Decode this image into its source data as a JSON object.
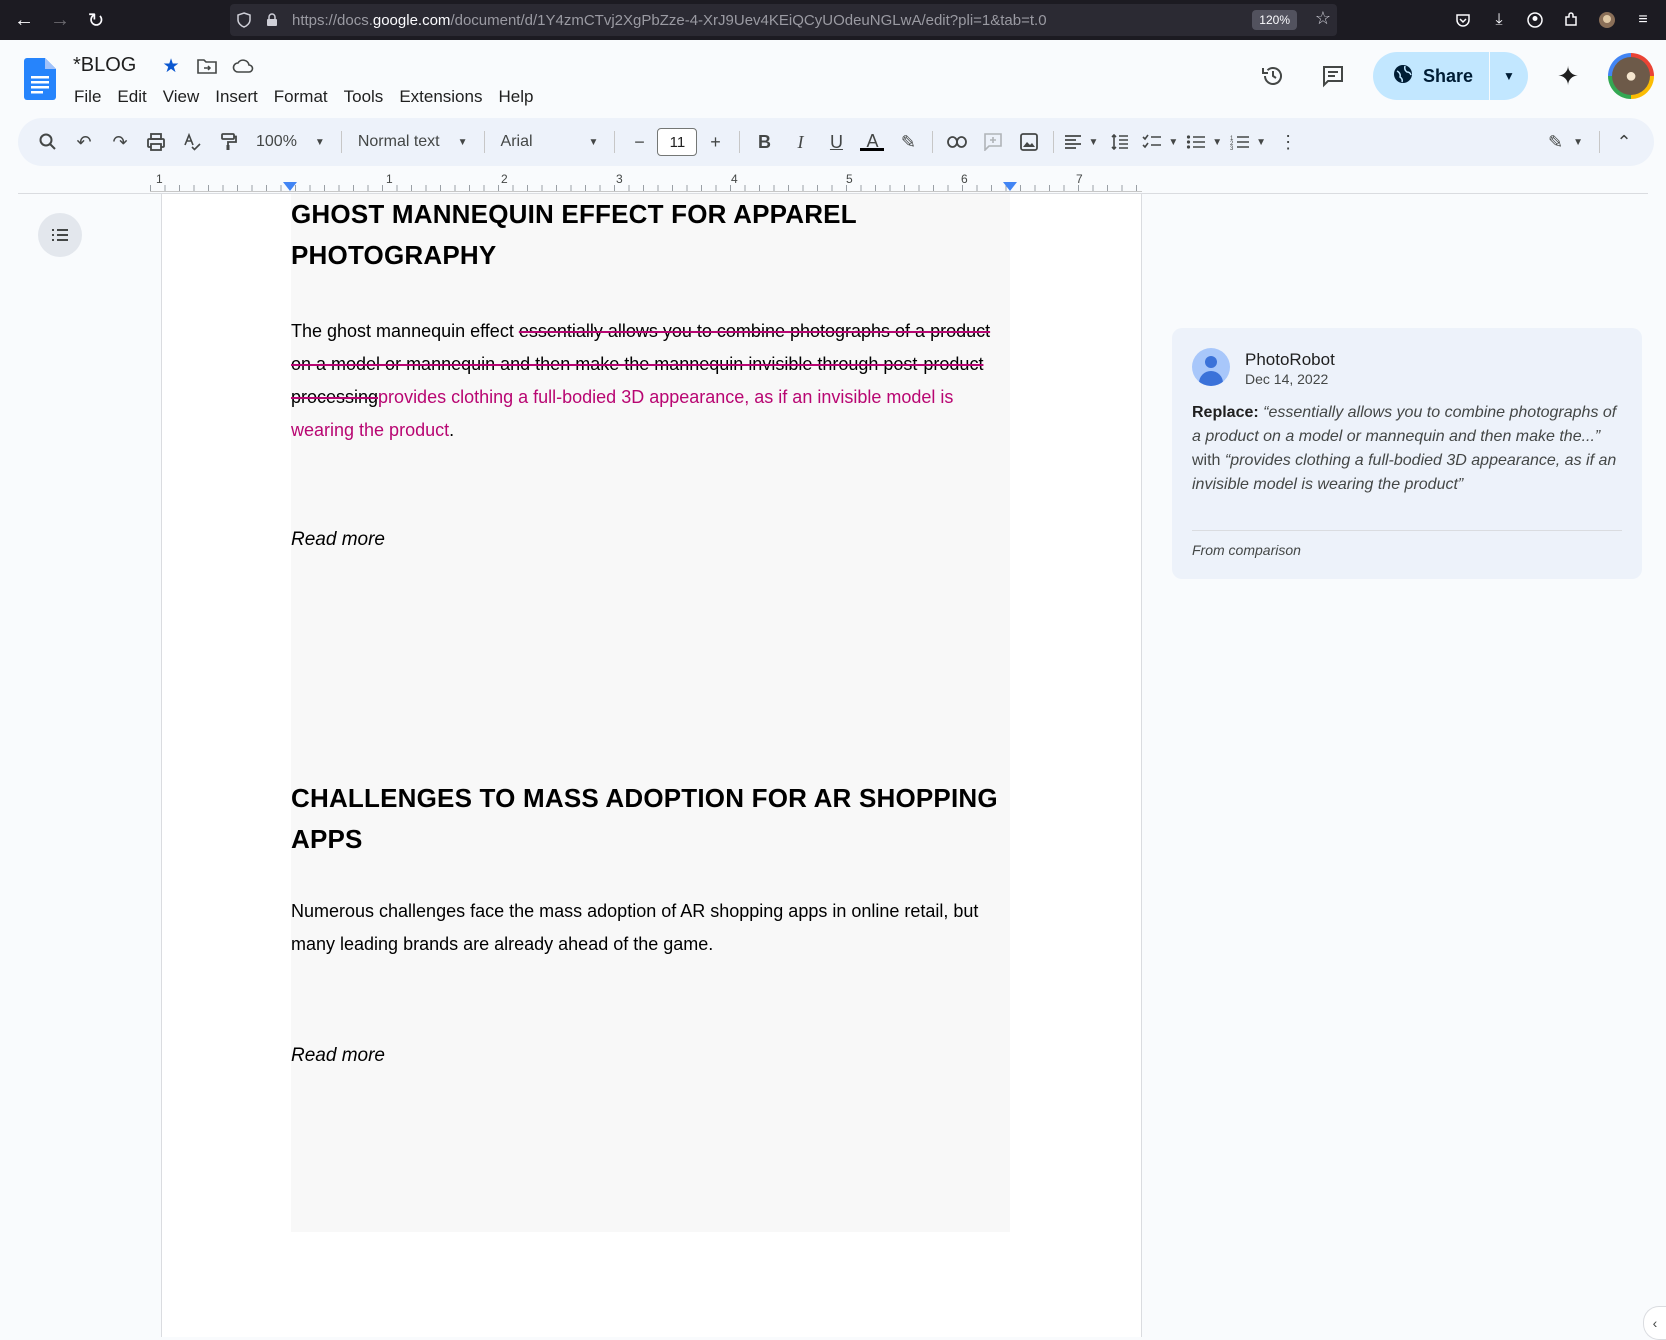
{
  "browser": {
    "url_prefix": "https://docs.",
    "url_domain": "google.com",
    "url_rest": "/document/d/1Y4zmCTvj2XgPbZze-4-XrJ9Uev4KEiQCyUOdeuNGLwA/edit?pli=1&tab=t.0",
    "zoom": "120%"
  },
  "docs": {
    "title": "*BLOG",
    "menu": [
      "File",
      "Edit",
      "View",
      "Insert",
      "Format",
      "Tools",
      "Extensions",
      "Help"
    ],
    "share_label": "Share"
  },
  "toolbar": {
    "zoom": "100%",
    "style": "Normal text",
    "font": "Arial",
    "font_size": "11"
  },
  "ruler": {
    "numbers": [
      "1",
      "1",
      "2",
      "3",
      "4",
      "5",
      "6",
      "7"
    ]
  },
  "document": {
    "heading1": "GHOST MANNEQUIN EFFECT FOR APPAREL PHOTOGRAPHY",
    "para1_start": "The ghost mannequin effect ",
    "para1_deleted": "essentially allows you to combine photographs of a product on a model or mannequin and then make the mannequin invisible through post-product processing",
    "para1_inserted": "provides clothing a full-bodied 3D appearance,  as if an invisible model is wearing the product",
    "para1_end": ".",
    "readmore1": "Read more",
    "heading2": "CHALLENGES TO MASS ADOPTION FOR AR SHOPPING APPS",
    "para2": "Numerous challenges face the mass adoption of AR shopping apps in online retail, but many leading brands are already ahead of the game.",
    "readmore2": "Read more"
  },
  "suggestion": {
    "author": "PhotoRobot",
    "date": "Dec 14, 2022",
    "replace_label": "Replace:",
    "old_text": "“essentially allows you to combine photographs of a product on a model or mannequin and then make the...”",
    "with_label": " with ",
    "new_text": "“provides clothing a full-bodied 3D appearance, as if an invisible model is wearing the product”",
    "footer": "From comparison"
  },
  "colors": {
    "suggestion": "#b80672",
    "share_bg": "#c2e7ff",
    "toolbar_bg": "#edf2fa"
  }
}
